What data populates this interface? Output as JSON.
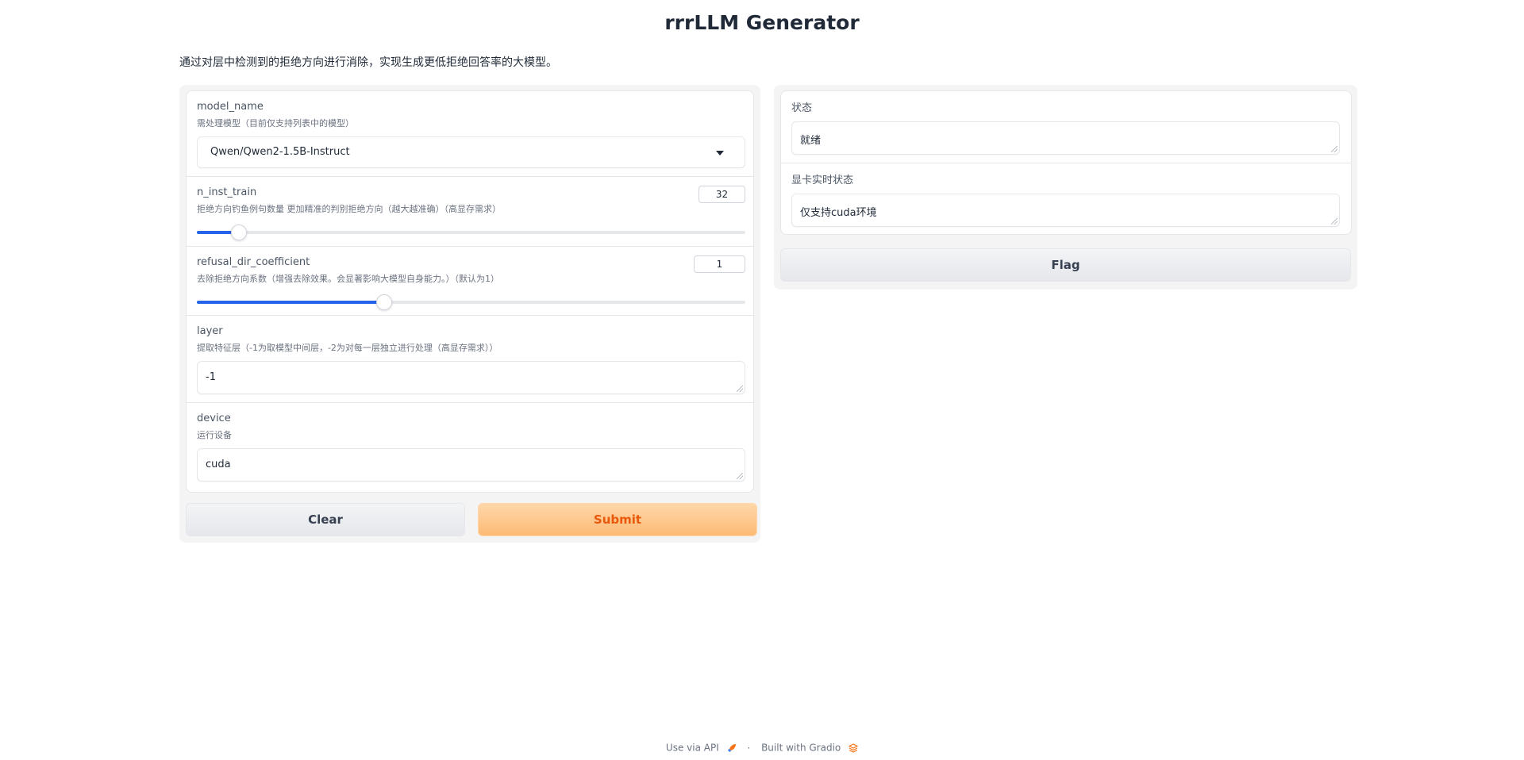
{
  "header": {
    "title": "rrrLLM Generator",
    "description": "通过对层中检测到的拒绝方向进行消除，实现生成更低拒绝回答率的大模型。"
  },
  "inputs": {
    "model_name": {
      "label": "model_name",
      "info": "需处理模型（目前仅支持列表中的模型）",
      "value": "Qwen/Qwen2-1.5B-Instruct"
    },
    "n_inst_train": {
      "label": "n_inst_train",
      "info": "拒绝方向钓鱼例句数量 更加精准的判别拒绝方向（越大越准确）（高显存需求）",
      "value": "32",
      "level": 0.075
    },
    "refusal_dir_coefficient": {
      "label": "refusal_dir_coefficient",
      "info": "去除拒绝方向系数（增强去除效果。会显著影响大模型自身能力。）（默认为1）",
      "value": "1",
      "level": 0.34
    },
    "layer": {
      "label": "layer",
      "info": "提取特征层（-1为取模型中间层，-2为对每一层独立进行处理（高显存需求））",
      "value": "-1"
    },
    "device": {
      "label": "device",
      "info": "运行设备",
      "value": "cuda"
    }
  },
  "actions": {
    "clear_label": "Clear",
    "submit_label": "Submit",
    "flag_label": "Flag"
  },
  "outputs": {
    "status": {
      "label": "状态",
      "value": "就绪"
    },
    "gpu_status": {
      "label": "显卡实时状态",
      "value": "仅支持cuda环境"
    }
  },
  "footer": {
    "api_label": "Use via API",
    "separator": "·",
    "built_label": "Built with Gradio"
  },
  "colors": {
    "accent": "#2563eb",
    "primary_button": "#fdba74",
    "primary_text": "#ea580c"
  }
}
